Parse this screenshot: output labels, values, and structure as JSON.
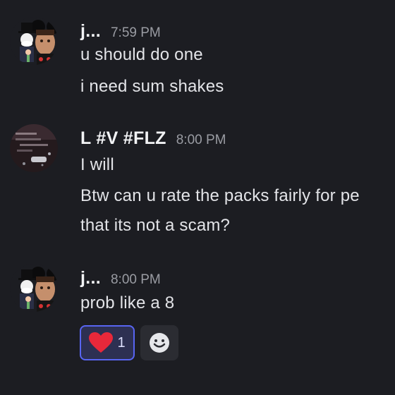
{
  "messages": [
    {
      "author": "j...",
      "time": "7:59 PM",
      "lines": [
        "u should do one",
        "i need sum shakes"
      ],
      "avatar_icon": "mickey-ears-avatar-icon"
    },
    {
      "author": "L #V #FLZ",
      "time": "8:00 PM",
      "lines": [
        "I will",
        "Btw can u rate the packs fairly for pe",
        "that its not a scam?"
      ],
      "avatar_icon": "screenshot-avatar-icon"
    },
    {
      "author": "j...",
      "time": "8:00 PM",
      "lines": [
        "prob like a 8"
      ],
      "avatar_icon": "mickey-ears-avatar-icon"
    }
  ],
  "reactions": [
    {
      "emoji": "heart-emoji-icon",
      "count": "1",
      "selected": true
    },
    {
      "emoji": "add-reaction-smiley-icon",
      "count": ""
    }
  ],
  "colors": {
    "background": "#1c1d22",
    "text": "#e3e4e8",
    "timestamp": "#9a9ca3",
    "reaction_selected_bg": "#2d3052",
    "reaction_selected_border": "#5865f2",
    "heart": "#e8283a"
  }
}
